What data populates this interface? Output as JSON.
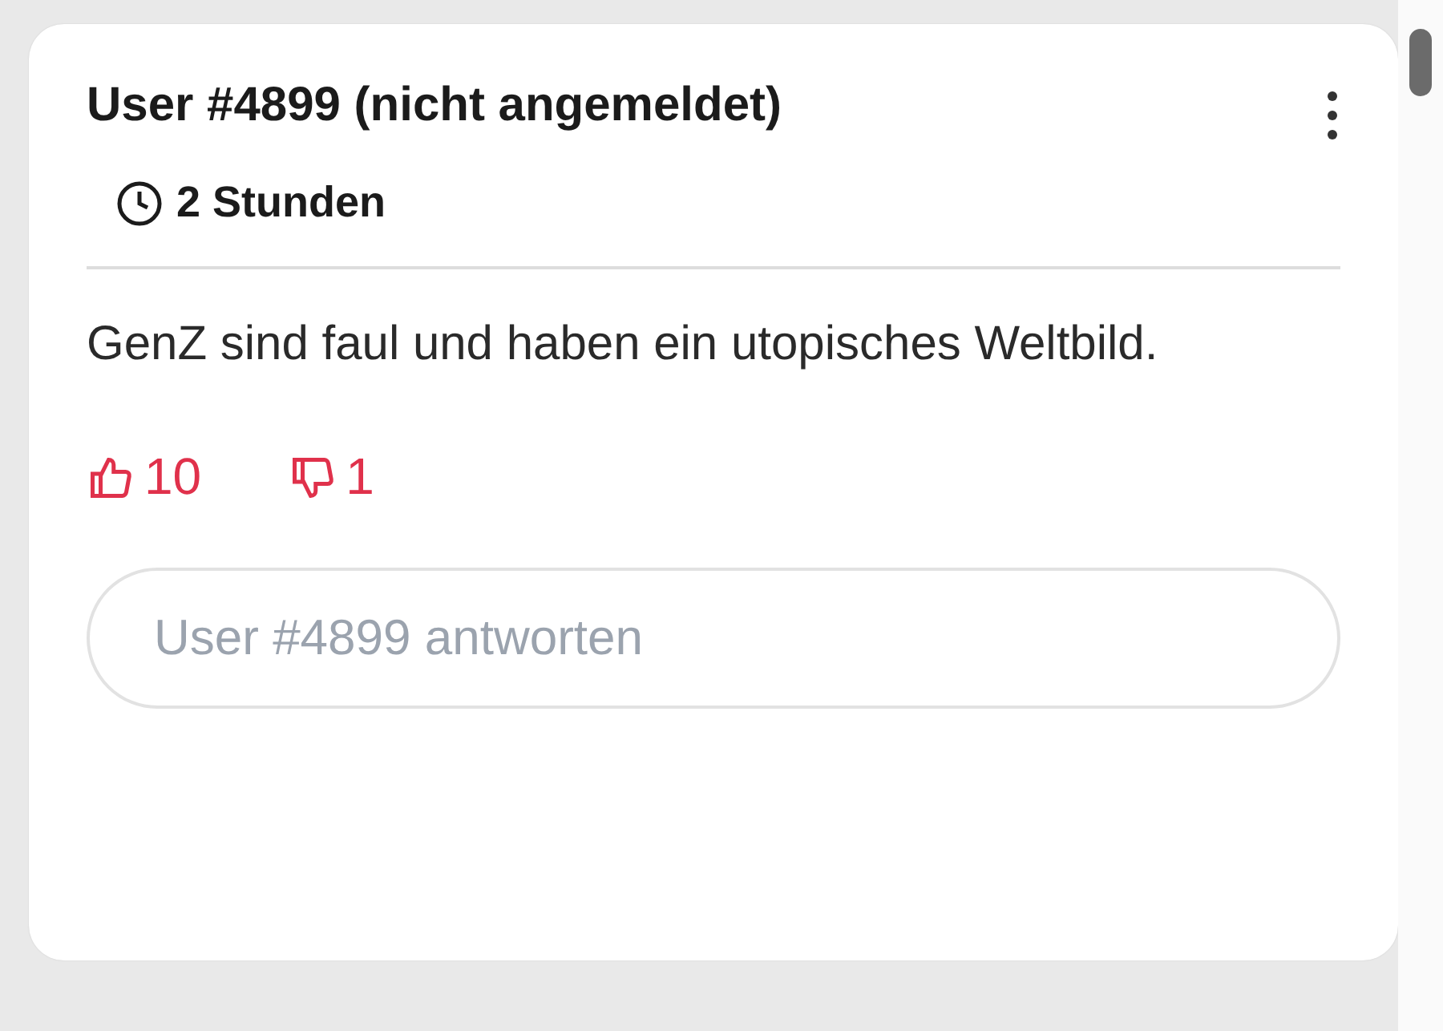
{
  "comment": {
    "author": "User #4899 (nicht angemeldet)",
    "time": "2 Stunden",
    "text": "GenZ sind faul und haben ein utopisches Weltbild.",
    "votes": [
      {
        "kind": "up",
        "count": "10"
      },
      {
        "kind": "down",
        "count": "1"
      }
    ],
    "reply": {
      "placeholder": "User #4899 antworten"
    }
  }
}
